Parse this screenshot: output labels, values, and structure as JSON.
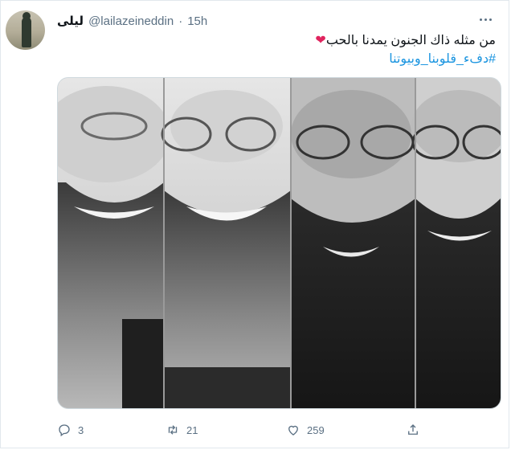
{
  "tweet": {
    "display_name": "ليلى",
    "handle": "@lailazeineddin",
    "separator": "·",
    "time": "15h",
    "text": "من مثله ذاك الجنون يمدنا بالحب",
    "hashtag": "#دفء_قلوبنا_وبيوتنا"
  },
  "actions": {
    "reply_count": "3",
    "retweet_count": "21",
    "like_count": "259"
  },
  "icons": {
    "heart_emoji": "heart-icon",
    "reply": "reply-icon",
    "retweet": "retweet-icon",
    "like": "like-icon",
    "share": "share-icon",
    "more": "more-icon"
  },
  "colors": {
    "link": "#1b95e0",
    "muted": "#5b7083",
    "heart": "#e0245e"
  }
}
